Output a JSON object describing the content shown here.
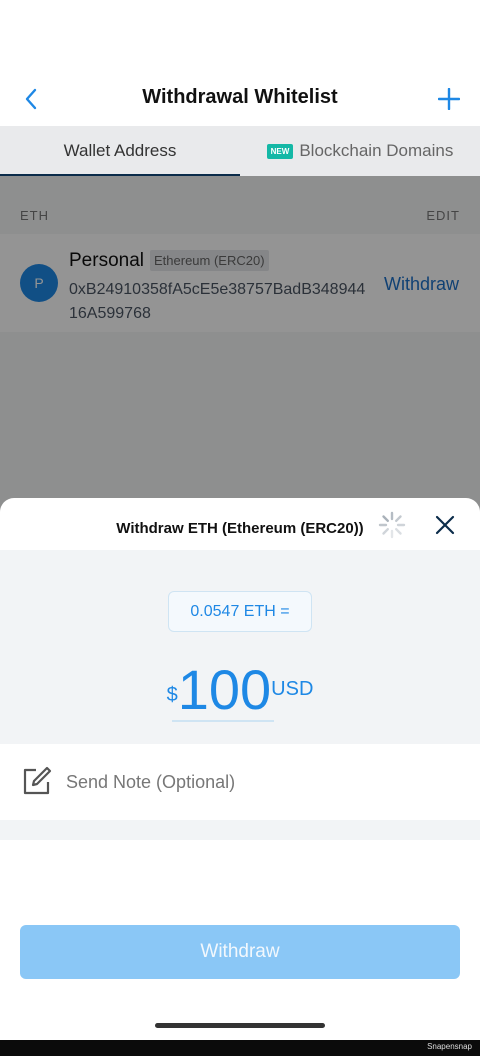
{
  "header": {
    "title": "Withdrawal Whitelist"
  },
  "tabs": [
    {
      "label": "Wallet Address",
      "active": true
    },
    {
      "label": "Blockchain Domains",
      "active": false,
      "badge": "NEW"
    }
  ],
  "list": {
    "section_label": "ETH",
    "edit_label": "EDIT",
    "entries": [
      {
        "avatar_letter": "P",
        "name": "Personal",
        "chain": "Ethereum (ERC20)",
        "address": "0xB24910358fA5cE5e38757BadB34894416A599768",
        "action_label": "Withdraw"
      }
    ]
  },
  "sheet": {
    "title": "Withdraw ETH (Ethereum (ERC20))",
    "eth_equivalent": "0.0547 ETH =",
    "amount_currency_symbol": "$",
    "amount_value": "100",
    "amount_unit": "USD",
    "note_placeholder": "Send Note (Optional)",
    "withdraw_label": "Withdraw"
  },
  "footer": {
    "watermark": "Snapensnap"
  },
  "colors": {
    "accent": "#1e88e5",
    "button_disabled": "#8ac7f6",
    "badge": "#14b8a6"
  },
  "icons": {
    "back": "chevron-left-icon",
    "add": "plus-icon",
    "close": "close-icon",
    "note": "edit-note-icon",
    "loading": "spinner-icon"
  }
}
